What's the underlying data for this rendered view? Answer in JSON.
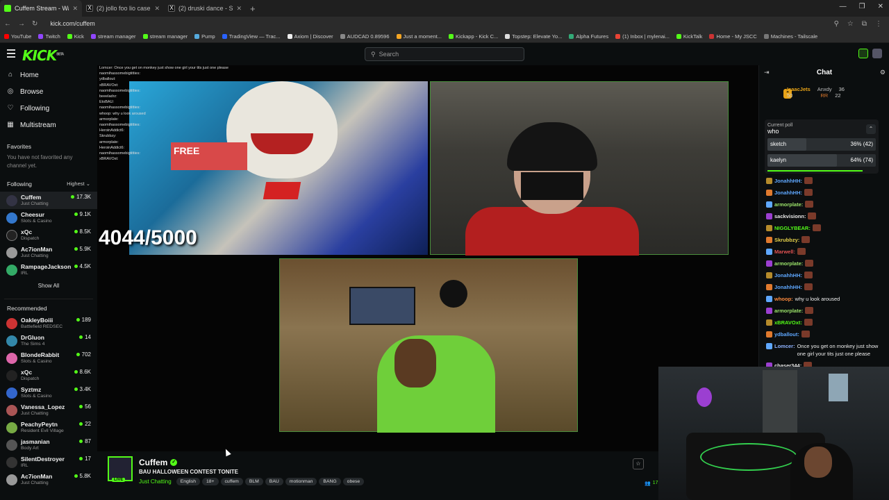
{
  "browser": {
    "tabs": [
      {
        "title": "Cuffem Stream - Watch Live",
        "active": true
      },
      {
        "title": "(2) jollo foo lio case day 6 - Sea"
      },
      {
        "title": "(2) druski dance - Search / X"
      }
    ],
    "url": "kick.com/cuffem",
    "bookmarks": [
      "YouTube",
      "Twitch",
      "Kick",
      "stream manager",
      "stream manager",
      "Pump",
      "TradingView — Trac...",
      "Axiom | Discover",
      "AUDCAD 0.89596",
      "Just a moment...",
      "Kickapp - Kick C...",
      "Topstep: Elevate Yo...",
      "Alpha Futures",
      "(1) Inbox | mylenai...",
      "KickTalk",
      "Home - My JSCC",
      "Machines - Tailscale"
    ]
  },
  "topbar": {
    "logo": "KICK",
    "logo_sup": "BETA",
    "search_placeholder": "Search"
  },
  "sidebar": {
    "nav": [
      {
        "label": "Home",
        "icon": "home-icon"
      },
      {
        "label": "Browse",
        "icon": "browse-icon"
      },
      {
        "label": "Following",
        "icon": "heart-icon"
      },
      {
        "label": "Multistream",
        "icon": "grid-icon"
      }
    ],
    "favorites_title": "Favorites",
    "favorites_empty": "You have not favorited any channel yet.",
    "following_title": "Following",
    "following_sort": "Highest",
    "following": [
      {
        "name": "Cuffem",
        "category": "Just Chatting",
        "viewers": "17.3K",
        "active": true
      },
      {
        "name": "Cheesur",
        "category": "Slots & Casino",
        "viewers": "9.1K"
      },
      {
        "name": "xQc",
        "category": "Dispatch",
        "viewers": "8.5K"
      },
      {
        "name": "Ac7ionMan",
        "category": "Just Chatting",
        "viewers": "5.9K"
      },
      {
        "name": "RampageJackson",
        "category": "IRL",
        "viewers": "4.5K"
      }
    ],
    "show_all": "Show All",
    "recommended_title": "Recommended",
    "recommended": [
      {
        "name": "OakleyBoiii",
        "category": "Battlefield REDSEC",
        "viewers": "189"
      },
      {
        "name": "DrGluon",
        "category": "The Sims 4",
        "viewers": "14"
      },
      {
        "name": "BlondeRabbit",
        "category": "Slots & Casino",
        "viewers": "702"
      },
      {
        "name": "xQc",
        "category": "Dispatch",
        "viewers": "8.6K"
      },
      {
        "name": "Syztmz",
        "category": "Slots & Casino",
        "viewers": "3.4K"
      },
      {
        "name": "Vanessa_Lopez",
        "category": "Just Chatting",
        "viewers": "56"
      },
      {
        "name": "PeachyPeytn",
        "category": "Resident Evil Village",
        "viewers": "22"
      },
      {
        "name": "jasmanian",
        "category": "Body Art",
        "viewers": "87"
      },
      {
        "name": "SilentDestroyer",
        "category": "IRL",
        "viewers": "17"
      },
      {
        "name": "Ac7ionMan",
        "category": "Just Chatting",
        "viewers": "5.8K"
      }
    ]
  },
  "player": {
    "counter": "4044/5000",
    "overlay_chat": [
      "Lomcer: Once you get on monkey just show one girl your tits just one please",
      "naomihassomebigtitties:",
      "ydballout:",
      "xBRAVOxt:",
      "naomihassomebigtitties:",
      "beeeladrz:",
      "EtoBAU:",
      "naomihassomebigtitties:",
      "whoop: why u look aroused",
      "armorplate:",
      "naomihassomebigtitties:",
      "HeroinAddict6:",
      "Skrubbzy:",
      "armorplate:",
      "HeroinAddict6:",
      "naomihassomebigtitties:",
      "xBRAVOxt:"
    ],
    "cam1_sign": "FREE"
  },
  "stream_info": {
    "streamer": "Cuffem",
    "live_badge": "LIVE",
    "title": "BAU HALLOWEEN CONTEST TONITE",
    "category": "Just Chatting",
    "tags": [
      "English",
      "18+",
      "cuffem",
      "BLM",
      "BAU",
      "motionman",
      "BANG",
      "obese"
    ],
    "viewer_count": "17"
  },
  "chat": {
    "title": "Chat",
    "gifters": [
      {
        "name": "IsaacJets",
        "amount": "50",
        "color": "#e8a317"
      },
      {
        "name": "Anxdy",
        "amount": "36",
        "color": "#bbbbbb"
      },
      {
        "name": "RR",
        "amount": "22",
        "color": "#e07a2e"
      }
    ],
    "gift_badge": "1",
    "poll": {
      "label": "Current poll",
      "question": "who",
      "options": [
        {
          "name": "sketch",
          "pct": 0.36,
          "display": "36% (42)"
        },
        {
          "name": "kaelyn",
          "pct": 0.64,
          "display": "64% (74)"
        }
      ],
      "timer_remaining": 0.88
    },
    "messages": [
      {
        "user": "JonahhHH:",
        "color": "#5fa8ff",
        "text": ""
      },
      {
        "user": "JonahhHH:",
        "color": "#5fa8ff",
        "text": ""
      },
      {
        "user": "armorplate:",
        "color": "#9be36a",
        "text": ""
      },
      {
        "user": "sackvisionn:",
        "color": "#e8e8e8",
        "text": ""
      },
      {
        "user": "NIGGLYBEAR:",
        "color": "#53fc18",
        "text": ""
      },
      {
        "user": "Skrubbzy:",
        "color": "#e6d24b",
        "text": ""
      },
      {
        "user": "Marwell:",
        "color": "#e05252",
        "text": ""
      },
      {
        "user": "armorplate:",
        "color": "#9be36a",
        "text": ""
      },
      {
        "user": "JonahhHH:",
        "color": "#5fa8ff",
        "text": ""
      },
      {
        "user": "JonahhHH:",
        "color": "#5fa8ff",
        "text": ""
      },
      {
        "user": "whoop:",
        "color": "#ff8a3d",
        "text": "why u look aroused"
      },
      {
        "user": "armorplate:",
        "color": "#9be36a",
        "text": ""
      },
      {
        "user": "xBRAVOxt:",
        "color": "#53fc18",
        "text": ""
      },
      {
        "user": "ydballout:",
        "color": "#5fa8ff",
        "text": ""
      },
      {
        "user": "Lomcer:",
        "color": "#8fb3ff",
        "text": "Once you get on monkey just show one girl your tits just one please"
      },
      {
        "user": "chaser344:",
        "color": "#e8e8e8",
        "text": ""
      }
    ]
  }
}
